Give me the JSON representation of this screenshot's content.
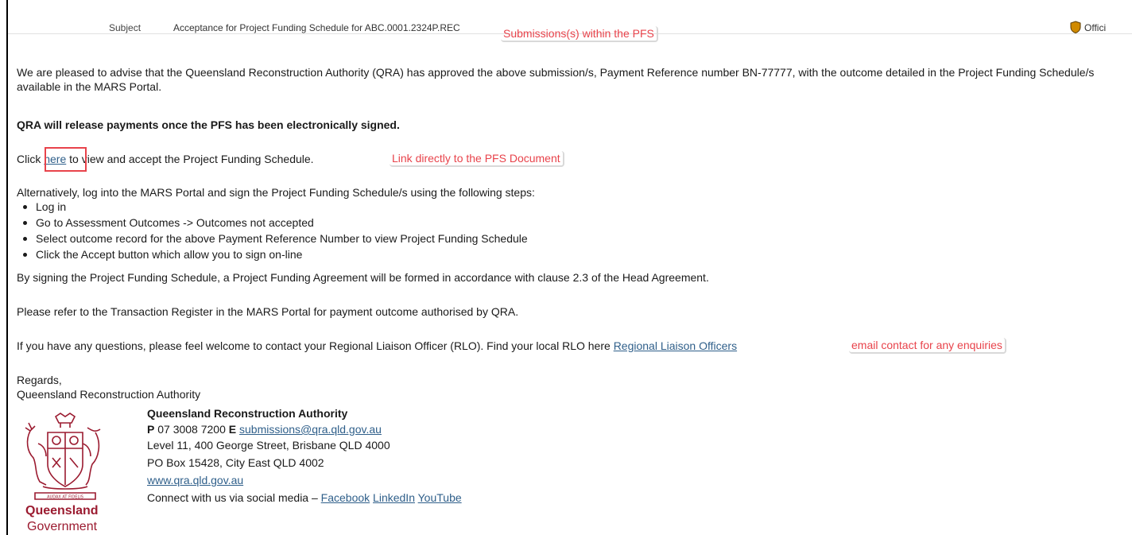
{
  "header": {
    "subject_label": "Subject",
    "subject_value": "Acceptance for Project Funding Schedule for ABC.0001.2324P.REC",
    "sensitivity_label": "Offici"
  },
  "annotations": {
    "submissions": "Submissions(s) within the PFS",
    "pfs_link": "Link directly to the PFS Document",
    "email_contact": "email contact for any enquiries"
  },
  "email": {
    "para1": "We are pleased to advise that the Queensland Reconstruction Authority (QRA) has approved the above submission/s, Payment Reference number BN-77777, with the outcome detailed in the Project Funding Schedule/s available in the MARS Portal.",
    "para2_bold": "QRA will release payments once the PFS has been electronically signed.",
    "click_prefix": "Click ",
    "click_link": "here",
    "click_suffix": " to view and accept the Project Funding Schedule.",
    "alt_intro": "Alternatively, log into the MARS Portal and sign the Project Funding Schedule/s using the following steps:",
    "steps": [
      "Log in",
      "Go to Assessment Outcomes -> Outcomes not accepted",
      "Select outcome record for the above Payment Reference Number to view Project Funding Schedule",
      "Click the Accept button which allow you to sign on-line"
    ],
    "signing_note": "By signing the Project Funding Schedule, a Project Funding Agreement will be formed in accordance with clause 2.3 of the Head Agreement.",
    "refer_note": "Please refer to the Transaction Register in the MARS Portal for payment outcome authorised by QRA.",
    "questions_prefix": "If you have any questions, please feel welcome to contact your Regional Liaison Officer (RLO). Find your local RLO here ",
    "questions_link": "Regional Liaison Officers",
    "regards": "Regards,",
    "sender": "Queensland Reconstruction Authority"
  },
  "signature": {
    "org_name": "Queensland Reconstruction Authority",
    "phone_label": "P",
    "phone": " 07 3008 7200 ",
    "email_label": "E",
    "email": "submissions@qra.qld.gov.au",
    "address1": "Level 11, 400 George Street, Brisbane QLD 4000",
    "address2": "PO Box 15428, City East QLD 4002",
    "website": "www.qra.qld.gov.au",
    "social_prefix": "Connect with us via social media – ",
    "social_links": [
      "Facebook",
      "LinkedIn",
      "YouTube"
    ],
    "logo_word1": "Queensland",
    "logo_word2": "Government",
    "crest_motto": "AUDAX AT FIDELIS"
  },
  "colors": {
    "link": "#2f5f8a",
    "annotation": "#e8434b",
    "crest": "#9b1b30",
    "sensitivity_shield": "#d08a00"
  }
}
